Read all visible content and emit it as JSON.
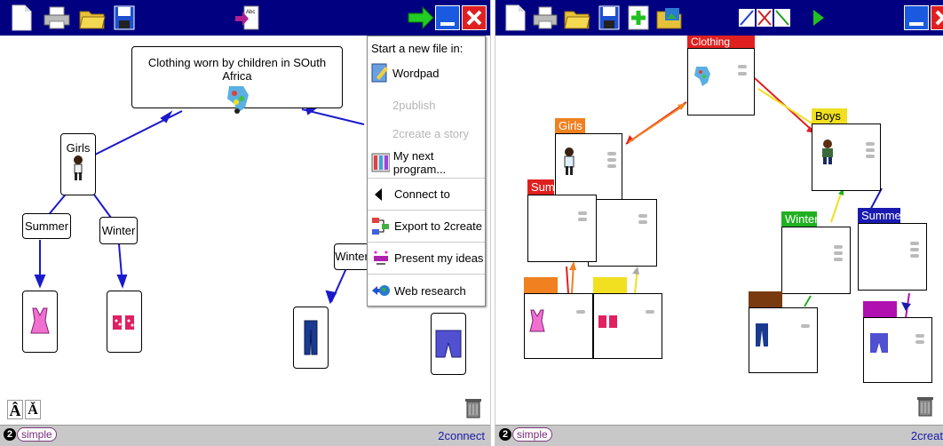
{
  "left": {
    "root_label": "Clothing worn by children in SOuth Africa",
    "nodes": {
      "girls": "Girls",
      "summer": "Summer",
      "winter": "Winter",
      "winter_right": "Winter"
    },
    "menu": {
      "title": "Start a new file in:",
      "items": [
        {
          "label": "Wordpad",
          "enabled": true
        },
        {
          "label": "2publish",
          "enabled": false
        },
        {
          "label": "2create a story",
          "enabled": false
        },
        {
          "label": "My next program...",
          "enabled": true
        },
        {
          "label": "Connect to",
          "enabled": true
        },
        {
          "label": "Export to 2create",
          "enabled": true
        },
        {
          "label": "Present my ideas",
          "enabled": true
        },
        {
          "label": "Web research",
          "enabled": true
        }
      ]
    },
    "status_app": "2connect",
    "logo_text": "simple",
    "logo_num": "2",
    "font_buttons": [
      "Â",
      "Ǎ"
    ]
  },
  "right": {
    "tags": {
      "clothing": "Clothing",
      "girls": "Girls",
      "boys": "Boys",
      "summer_left": "Summ",
      "winter": "Winter",
      "summer_right": "Summer"
    },
    "status_app": "2creat",
    "logo_text": "simple",
    "logo_num": "2"
  },
  "colors": {
    "toolbar": "#000080",
    "status": "#c8c8c8",
    "arrow_blue": "#1a1acc",
    "tag_orange": "#f08020",
    "tag_yellow": "#f0e020",
    "tag_red": "#e02020",
    "tag_green": "#20b020",
    "tag_blue": "#1a1ab0",
    "tag_brown": "#7a3a10",
    "tag_purple": "#b010b0"
  }
}
